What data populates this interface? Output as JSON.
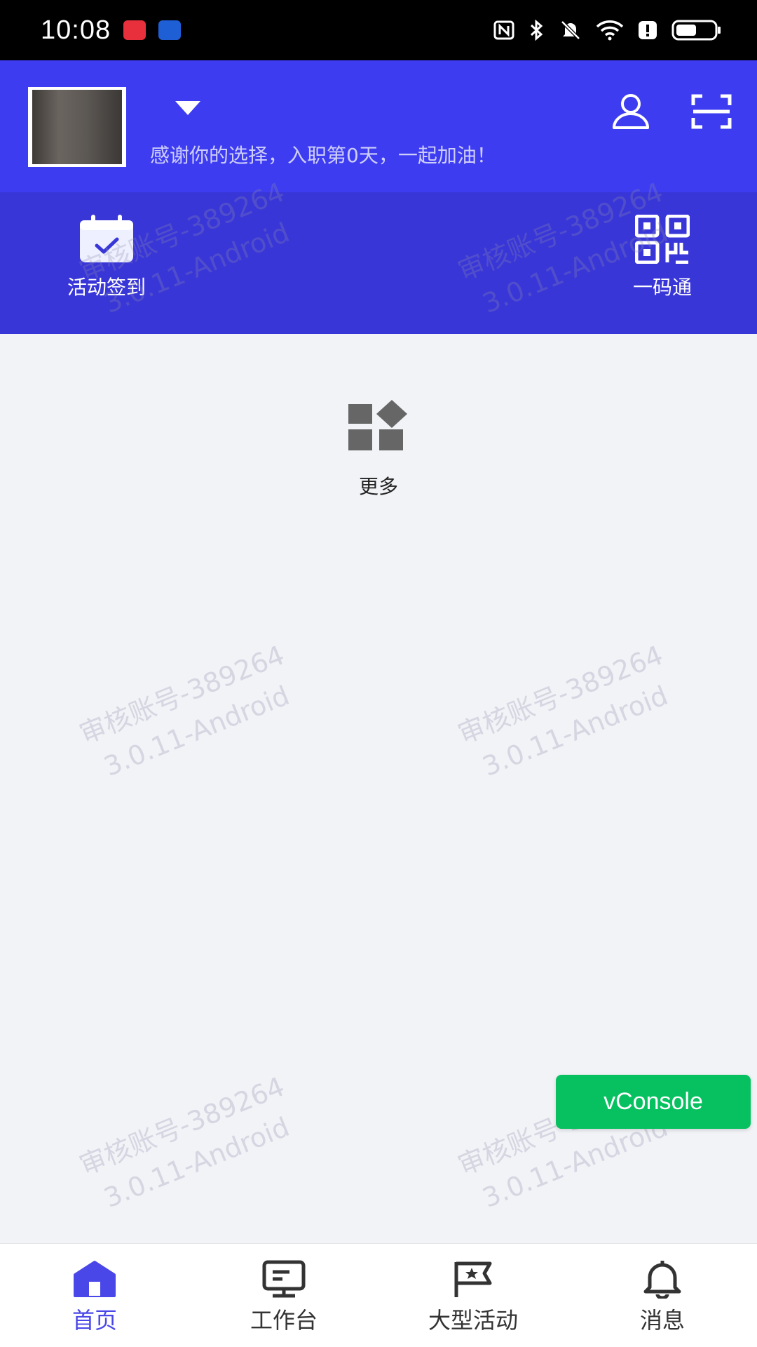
{
  "status_bar": {
    "time": "10:08"
  },
  "header": {
    "welcome": "感谢你的选择，入职第0天，一起加油！"
  },
  "quick_actions": [
    {
      "label": "活动签到",
      "icon": "calendar-check-icon"
    },
    {
      "label": "一码通",
      "icon": "qr-code-icon"
    }
  ],
  "main": {
    "more_label": "更多"
  },
  "watermark": {
    "line1": "审核账号-389264",
    "line2": "3.0.11-Android"
  },
  "vconsole": {
    "label": "vConsole"
  },
  "tabbar": {
    "items": [
      {
        "label": "首页",
        "icon": "home-icon",
        "active": true
      },
      {
        "label": "工作台",
        "icon": "workbench-icon",
        "active": false
      },
      {
        "label": "大型活动",
        "icon": "flag-icon",
        "active": false
      },
      {
        "label": "消息",
        "icon": "bell-icon",
        "active": false
      }
    ]
  },
  "colors": {
    "header_bg": "#3d3cf0",
    "quick_bar_bg": "#3936d8",
    "page_bg": "#f2f3f7",
    "active_tab": "#4a47e8",
    "vconsole_bg": "#07c160"
  }
}
